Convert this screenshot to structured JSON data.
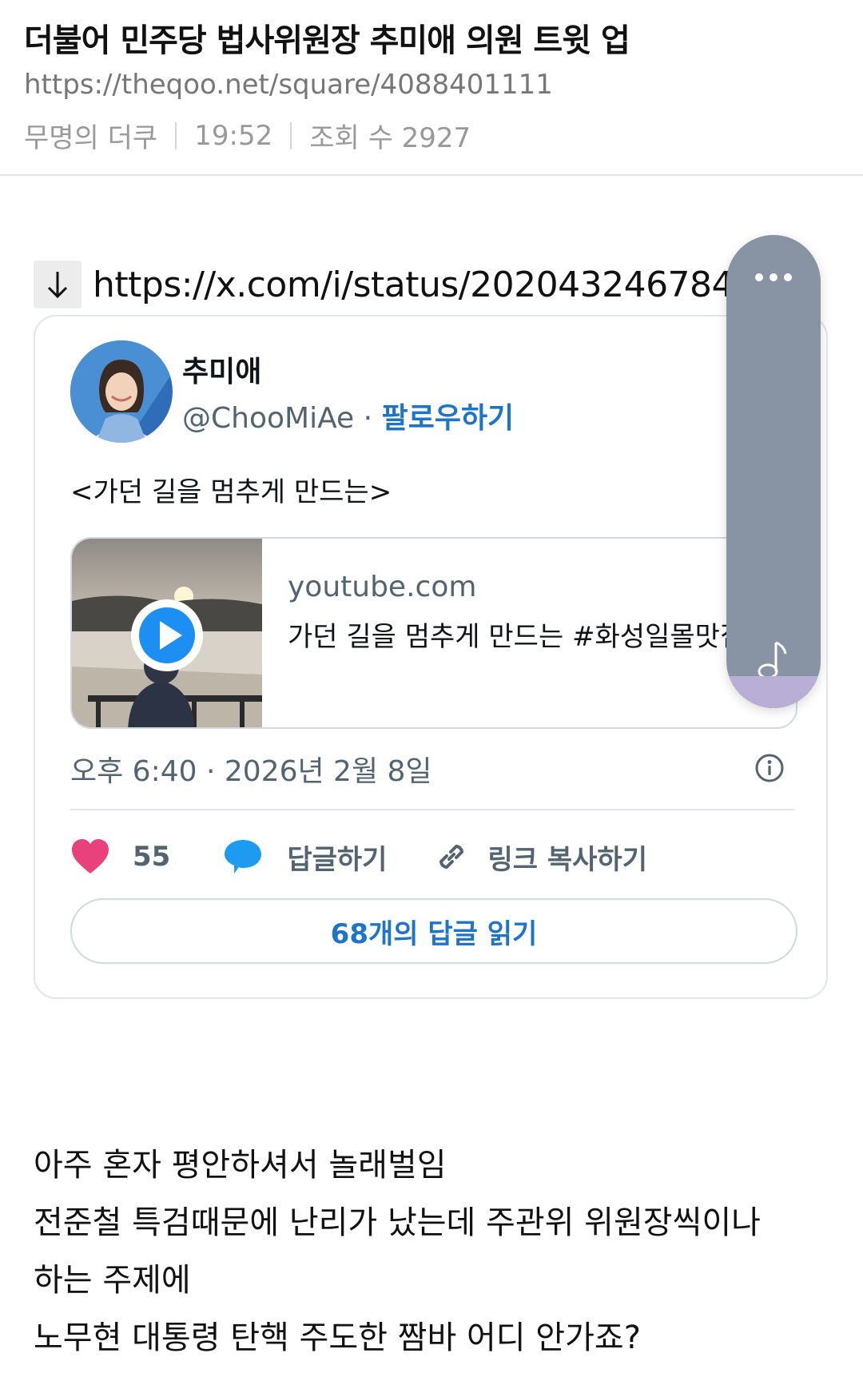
{
  "post": {
    "title": "더불어 민주당 법사위원장 추미애 의원 트윗 업",
    "url": "https://theqoo.net/square/4088401111",
    "author": "무명의 더쿠",
    "time": "19:52",
    "views": "조회 수 2927"
  },
  "embed": {
    "link_text": "https://x.com/i/status/202043246784981",
    "arrow_icon": "arrow-down-icon"
  },
  "tweet": {
    "author_name": "추미애",
    "handle": "@ChooMiAe",
    "separator": "·",
    "follow_label": "팔로우하기",
    "text": "<가던 길을 멈추게 만드는>",
    "preview": {
      "domain": "youtube.com",
      "title": "가던 길을 멈추게 만드는 #화성일몰맛집",
      "play_icon": "play-icon"
    },
    "timestamp": "오후 6:40 · 2026년 2월 8일",
    "likes": "55",
    "reply_label": "답글하기",
    "copy_link_label": "링크 복사하기",
    "read_replies_label": "68개의 답글 읽기",
    "colors": {
      "like": "#e8417b",
      "reply": "#1d9bf0",
      "link": "#1d74c8"
    }
  },
  "floating_panel": {
    "top_icon": "more-horizontal-icon",
    "bottom_icon": "music-note-icon"
  },
  "body": {
    "lines": [
      "아주 혼자 평안하셔서 놀래벌임",
      "전준철 특검때문에 난리가 났는데 주관위 위원장씩이나",
      "하는 주제에",
      "노무현 대통령 탄핵 주도한 짬바 어디 안가죠?"
    ]
  }
}
